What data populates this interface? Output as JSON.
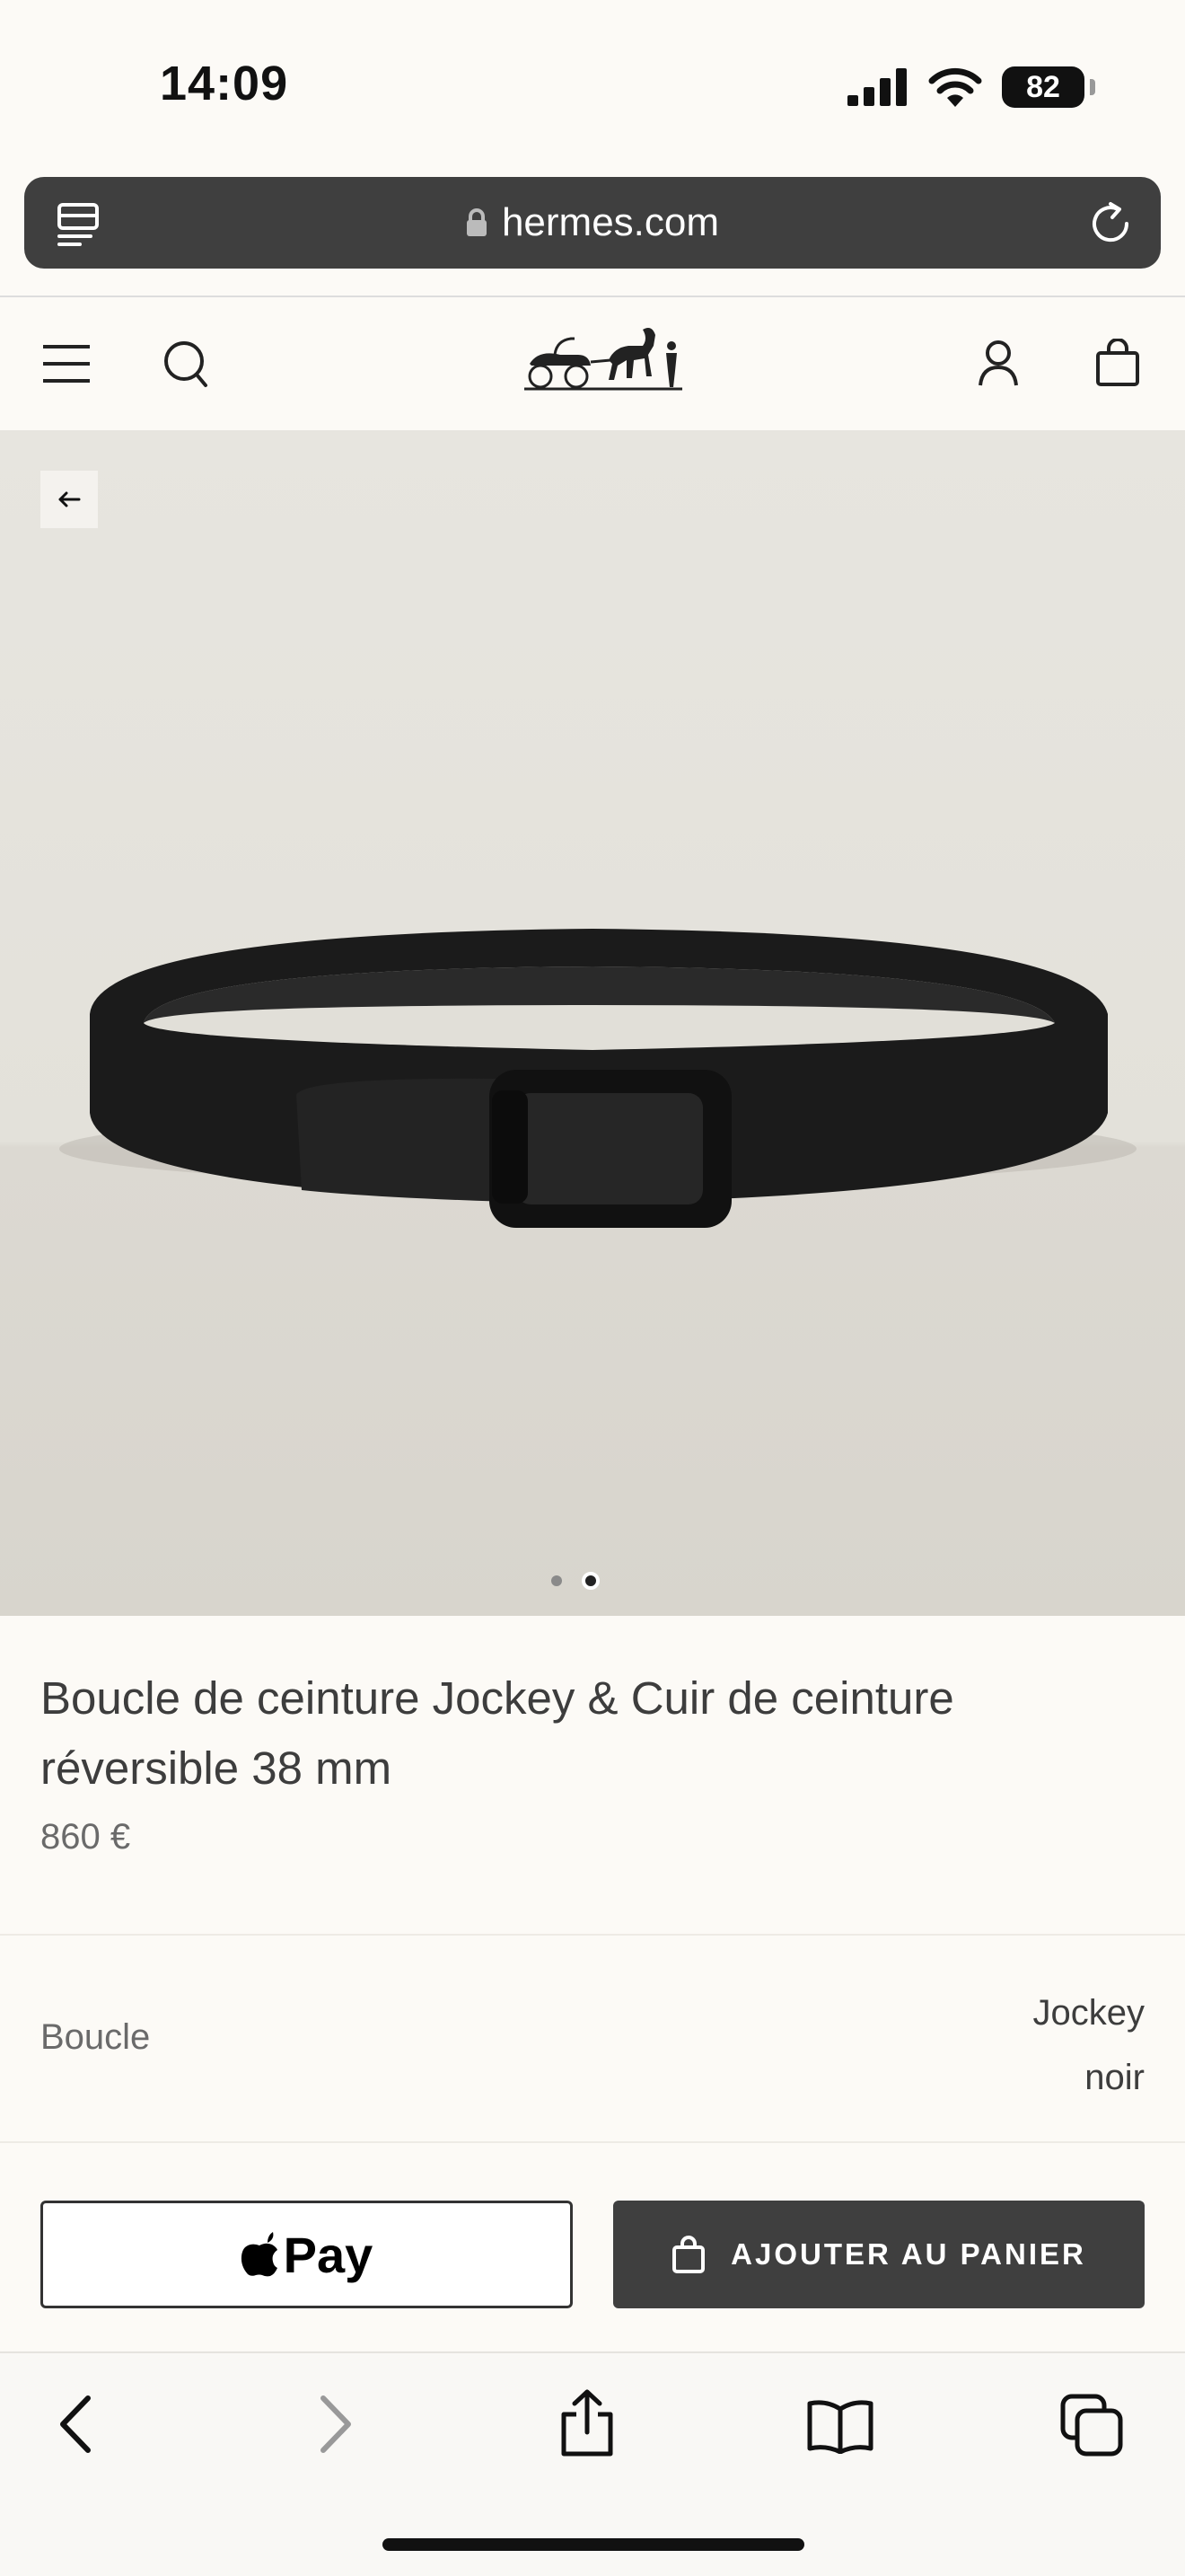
{
  "status_bar": {
    "time": "14:09",
    "battery": "82"
  },
  "browser": {
    "url": "hermes.com"
  },
  "product": {
    "title": "Boucle de ceinture Jockey & Cuir de ceinture réversible 38 mm",
    "price": "860 €",
    "image_count": 2,
    "active_image": 2,
    "attribute": {
      "label": "Boucle",
      "value_1": "Jockey",
      "value_2": "noir"
    }
  },
  "actions": {
    "apple_pay_label": "Pay",
    "add_to_cart_label": "AJOUTER AU PANIER"
  },
  "colors": {
    "background": "#fcfaf6",
    "dark_button": "#3f3f3f",
    "text": "#3d3d3d"
  }
}
